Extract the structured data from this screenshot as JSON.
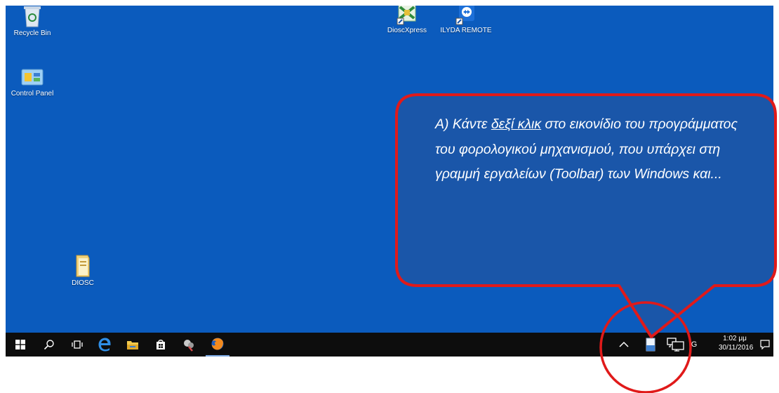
{
  "desktop": {
    "icons": [
      {
        "label": "Recycle Bin",
        "icon": "recycle-bin-icon"
      },
      {
        "label": "Control Panel",
        "icon": "control-panel-icon"
      },
      {
        "label": "DIOSC",
        "icon": "folder-icon"
      },
      {
        "label": "DioscXpress",
        "icon": "dioscxpress-icon"
      },
      {
        "label": "ILYDA REMOTE",
        "icon": "teamviewer-icon"
      }
    ]
  },
  "callout": {
    "part1": "A) Κάντε ",
    "link": "δεξί κλικ",
    "part2": " στο εικονίδιο του προγράμματος του φορολογικού μηχανισμού, που υπάρχει στη γραμμή εργαλείων (Toolbar) των Windows και..."
  },
  "taskbar": {
    "pinned": [
      "start-icon",
      "search-icon",
      "task-view-icon",
      "edge-icon",
      "file-explorer-icon",
      "store-icon",
      "app-icon",
      "firefox-icon"
    ],
    "tray": {
      "icons": [
        "chevron-up-icon",
        "fiscal-device-icon",
        "network-icon",
        "language-indicator"
      ],
      "lang": "G",
      "time": "1:02 μμ",
      "date": "30/11/2016"
    }
  },
  "colors": {
    "desktop": "#0b5bbd",
    "callout_fill": "#1a56a9",
    "callout_border": "#e01a1a",
    "taskbar": "#0d0d0d"
  }
}
